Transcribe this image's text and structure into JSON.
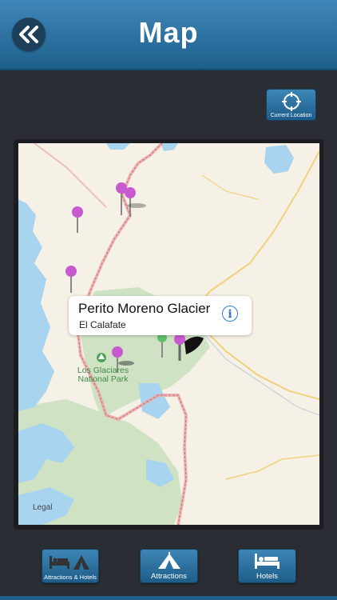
{
  "header": {
    "title": "Map"
  },
  "current_location": {
    "label": "Current Location"
  },
  "map": {
    "callout": {
      "title": "Perito Moreno Glacier",
      "subtitle": "El Calafate"
    },
    "park_label_line1": "Los Glaciares",
    "park_label_line2": "National Park",
    "legal": "Legal"
  },
  "tabs": [
    {
      "label": "Attractions & Hotels",
      "icon": "bed-and-tent-icon"
    },
    {
      "label": "Attractions",
      "icon": "tent-icon"
    },
    {
      "label": "Hotels",
      "icon": "bed-icon"
    }
  ],
  "colors": {
    "header": "#2f77a8",
    "button": "#2a73a4",
    "pin": "#c85ad0",
    "background": "#2a2d33"
  }
}
